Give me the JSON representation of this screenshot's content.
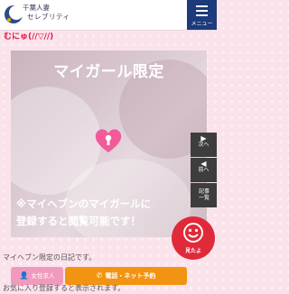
{
  "header": {
    "logo_line1": "千葉人妻",
    "logo_line2": "セレブリティ",
    "menu_label": "メニュー",
    "menu_icon": "hamburger-icon",
    "logo_icon": "crescent-moon-icon"
  },
  "page": {
    "title": "むにゅ(//▽//)"
  },
  "locked": {
    "title": "マイガール限定",
    "note_line1": "※マイヘブンのマイガールに",
    "note_line2": "登録すると閲覧可能です！",
    "lock_icon": "heart-lock-icon"
  },
  "side_nav": {
    "next": "次へ",
    "prev": "前へ",
    "list": "記事一覧"
  },
  "fab": {
    "label": "見たよ",
    "icon": "smiley-face-icon"
  },
  "notice": {
    "line1": "マイヘブン限定の日記です。",
    "line2": "お気に入り登録すると表示されます。"
  },
  "bottom_bar": {
    "female_label": "女性求人",
    "reserve_label": "電話・ネット予約",
    "female_icon": "person-icon",
    "phone_icon": "phone-icon"
  },
  "colors": {
    "accent_navy": "#1d3a7a",
    "title_red": "#e01a46",
    "fab_red": "#e02a3a",
    "reserve_orange": "#f29412",
    "female_pink": "#f09bbd",
    "background_pink": "#fbe3ec",
    "heart_pink": "#f25a9a"
  }
}
